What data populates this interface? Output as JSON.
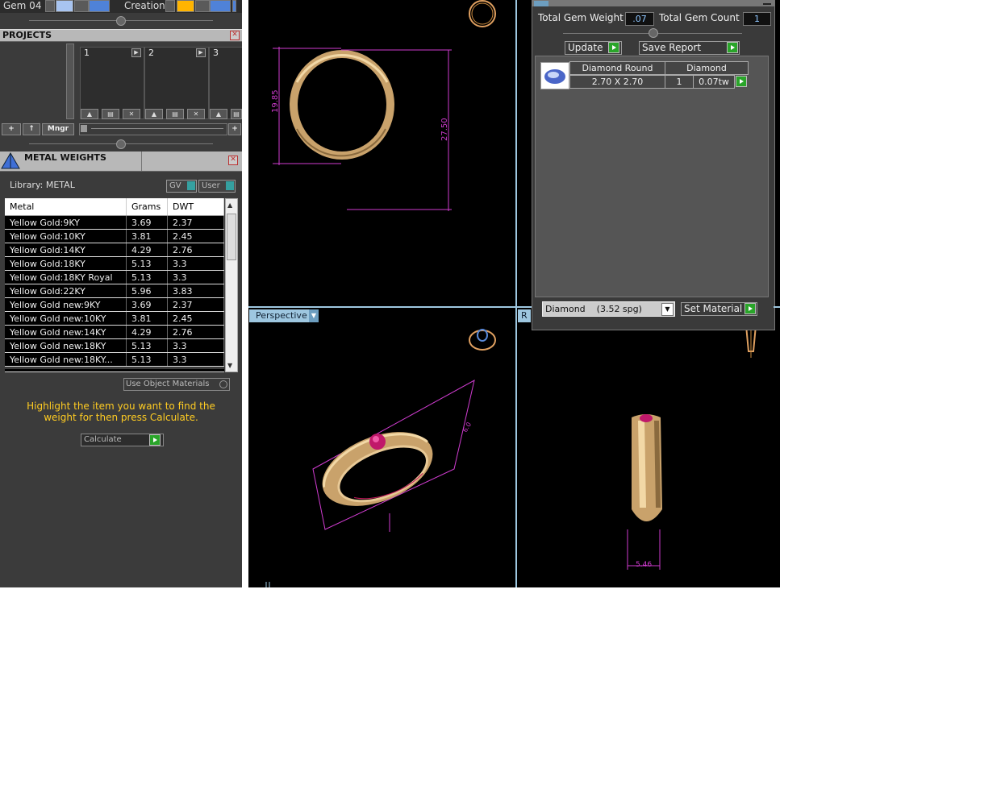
{
  "topbar": {
    "gem_label": "Gem 04",
    "creation_label": "Creation"
  },
  "projects": {
    "title": "PROJECTS",
    "slots": [
      "1",
      "2",
      "3"
    ],
    "manager_label": "Mngr",
    "add_label": "+",
    "up_label": "↑"
  },
  "metal_weights": {
    "title": "METAL WEIGHTS",
    "library": "Library: METAL",
    "gv_label": "GV",
    "user_label": "User",
    "columns": [
      "Metal",
      "Grams",
      "DWT"
    ],
    "rows": [
      [
        "Yellow Gold:9KY",
        "3.69",
        "2.37"
      ],
      [
        "Yellow Gold:10KY",
        "3.81",
        "2.45"
      ],
      [
        "Yellow Gold:14KY",
        "4.29",
        "2.76"
      ],
      [
        "Yellow Gold:18KY",
        "5.13",
        "3.3"
      ],
      [
        "Yellow Gold:18KY Royal",
        "5.13",
        "3.3"
      ],
      [
        "Yellow Gold:22KY",
        "5.96",
        "3.83"
      ],
      [
        "Yellow Gold new:9KY",
        "3.69",
        "2.37"
      ],
      [
        "Yellow Gold new:10KY",
        "3.81",
        "2.45"
      ],
      [
        "Yellow Gold new:14KY",
        "4.29",
        "2.76"
      ],
      [
        "Yellow Gold new:18KY",
        "5.13",
        "3.3"
      ],
      [
        "Yellow Gold new:18KY...",
        "5.13",
        "3.3"
      ]
    ],
    "use_object_materials": "Use Object Materials",
    "hint": "Highlight the item you want to find the weight for then press Calculate.",
    "calculate_label": "Calculate"
  },
  "viewports": {
    "perspective_label": "Perspective",
    "right_label": "R",
    "dim_top_height": "19.85",
    "dim_top_outer": "27.50",
    "dim_side_width": "5.46"
  },
  "gem_panel": {
    "total_weight_label": "Total Gem Weight",
    "total_weight_value": ".07",
    "total_count_label": "Total Gem Count",
    "total_count_value": "1",
    "update_label": "Update",
    "save_report_label": "Save Report",
    "row": {
      "shape": "Diamond Round",
      "type": "Diamond",
      "size": "2.70 X 2.70",
      "qty": "1",
      "weight": "0.07tw"
    },
    "material_select": "Diamond    (3.52 spg)",
    "set_material_label": "Set Material"
  },
  "colors": {
    "accent": "#9ec7e0",
    "hint": "#ffcc22",
    "gold": "#d9b47a",
    "dimension": "#d03cd0",
    "ruby": "#c0186a"
  }
}
